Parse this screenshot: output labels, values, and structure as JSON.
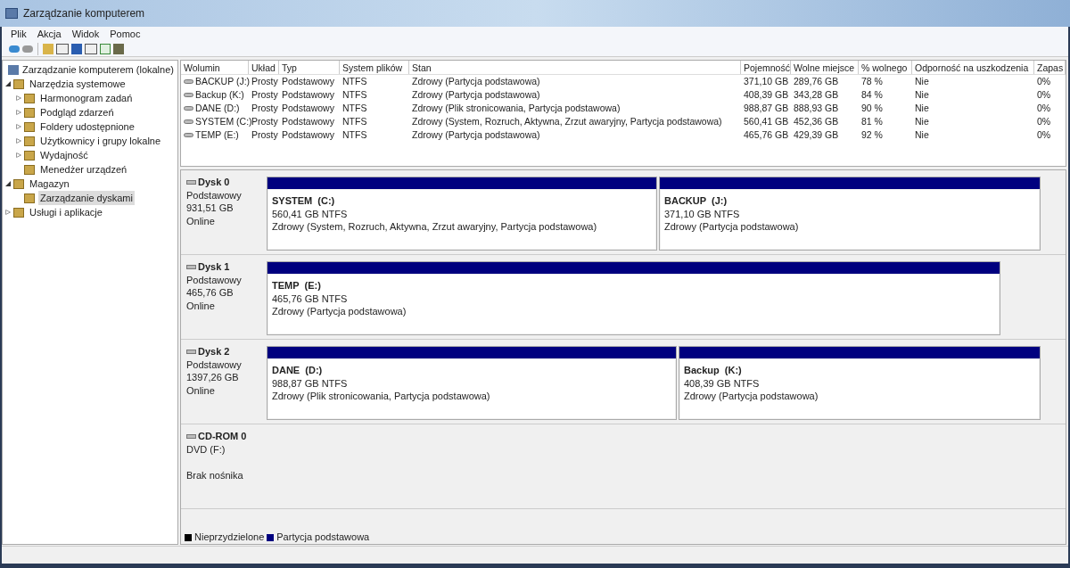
{
  "window": {
    "title": "Zarządzanie komputerem"
  },
  "menu": [
    "Plik",
    "Akcja",
    "Widok",
    "Pomoc"
  ],
  "tree": {
    "label": "Zarządzanie komputerem (lokalne)",
    "children": [
      {
        "label": "Narzędzia systemowe",
        "expanded": true,
        "selected": false,
        "children": [
          {
            "label": "Harmonogram zadań",
            "expanded": false,
            "selected": false
          },
          {
            "label": "Podgląd zdarzeń",
            "expanded": false,
            "selected": false
          },
          {
            "label": "Foldery udostępnione",
            "expanded": false,
            "selected": false
          },
          {
            "label": "Użytkownicy i grupy lokalne",
            "expanded": false,
            "selected": false
          },
          {
            "label": "Wydajność",
            "expanded": false,
            "selected": false
          },
          {
            "label": "Menedżer urządzeń",
            "selected": false
          }
        ]
      },
      {
        "label": "Magazyn",
        "expanded": true,
        "selected": false,
        "children": [
          {
            "label": "Zarządzanie dyskami",
            "selected": true
          }
        ]
      },
      {
        "label": "Usługi i aplikacje",
        "expanded": false,
        "selected": false
      }
    ]
  },
  "table": {
    "columns": [
      "Wolumin",
      "Układ",
      "Typ",
      "System plików",
      "Stan",
      "Pojemność",
      "Wolne miejsce",
      "% wolnego",
      "Odporność na uszkodzenia",
      "Zapas"
    ],
    "rows": [
      [
        "BACKUP (J:)",
        "Prosty",
        "Podstawowy",
        "NTFS",
        "Zdrowy (Partycja podstawowa)",
        "371,10 GB",
        "289,76 GB",
        "78 %",
        "Nie",
        "0%"
      ],
      [
        "Backup (K:)",
        "Prosty",
        "Podstawowy",
        "NTFS",
        "Zdrowy (Partycja podstawowa)",
        "408,39 GB",
        "343,28 GB",
        "84 %",
        "Nie",
        "0%"
      ],
      [
        "DANE (D:)",
        "Prosty",
        "Podstawowy",
        "NTFS",
        "Zdrowy (Plik stronicowania, Partycja podstawowa)",
        "988,87 GB",
        "888,93 GB",
        "90 %",
        "Nie",
        "0%"
      ],
      [
        "SYSTEM (C:)",
        "Prosty",
        "Podstawowy",
        "NTFS",
        "Zdrowy (System, Rozruch, Aktywna, Zrzut awaryjny, Partycja podstawowa)",
        "560,41 GB",
        "452,36 GB",
        "81 %",
        "Nie",
        "0%"
      ],
      [
        "TEMP (E:)",
        "Prosty",
        "Podstawowy",
        "NTFS",
        "Zdrowy (Partycja podstawowa)",
        "465,76 GB",
        "429,39 GB",
        "92 %",
        "Nie",
        "0%"
      ]
    ]
  },
  "disks": [
    {
      "name": "Dysk 0",
      "type": "Podstawowy",
      "size": "931,51 GB",
      "status": "Online",
      "partitions": [
        {
          "name": "SYSTEM  (C:)",
          "size": "560,41 GB NTFS",
          "state": "Zdrowy (System, Rozruch, Aktywna, Zrzut awaryjny, Partycja podstawowa)"
        },
        {
          "name": "BACKUP  (J:)",
          "size": "371,10 GB NTFS",
          "state": "Zdrowy (Partycja podstawowa)"
        }
      ]
    },
    {
      "name": "Dysk 1",
      "type": "Podstawowy",
      "size": "465,76 GB",
      "status": "Online",
      "partitions": [
        {
          "name": "TEMP  (E:)",
          "size": "465,76 GB NTFS",
          "state": "Zdrowy (Partycja podstawowa)"
        }
      ]
    },
    {
      "name": "Dysk 2",
      "type": "Podstawowy",
      "size": "1397,26 GB",
      "status": "Online",
      "partitions": [
        {
          "name": "DANE  (D:)",
          "size": "988,87 GB NTFS",
          "state": "Zdrowy (Plik stronicowania, Partycja podstawowa)"
        },
        {
          "name": "Backup  (K:)",
          "size": "408,39 GB NTFS",
          "state": "Zdrowy (Partycja podstawowa)"
        }
      ]
    },
    {
      "name": "CD-ROM 0",
      "type": "DVD (F:)",
      "status": "Brak nośnika"
    }
  ],
  "legend": [
    {
      "label": "Nieprzydzielone",
      "color": "#000000"
    },
    {
      "label": "Partycja podstawowa",
      "color": "#00007f"
    }
  ]
}
